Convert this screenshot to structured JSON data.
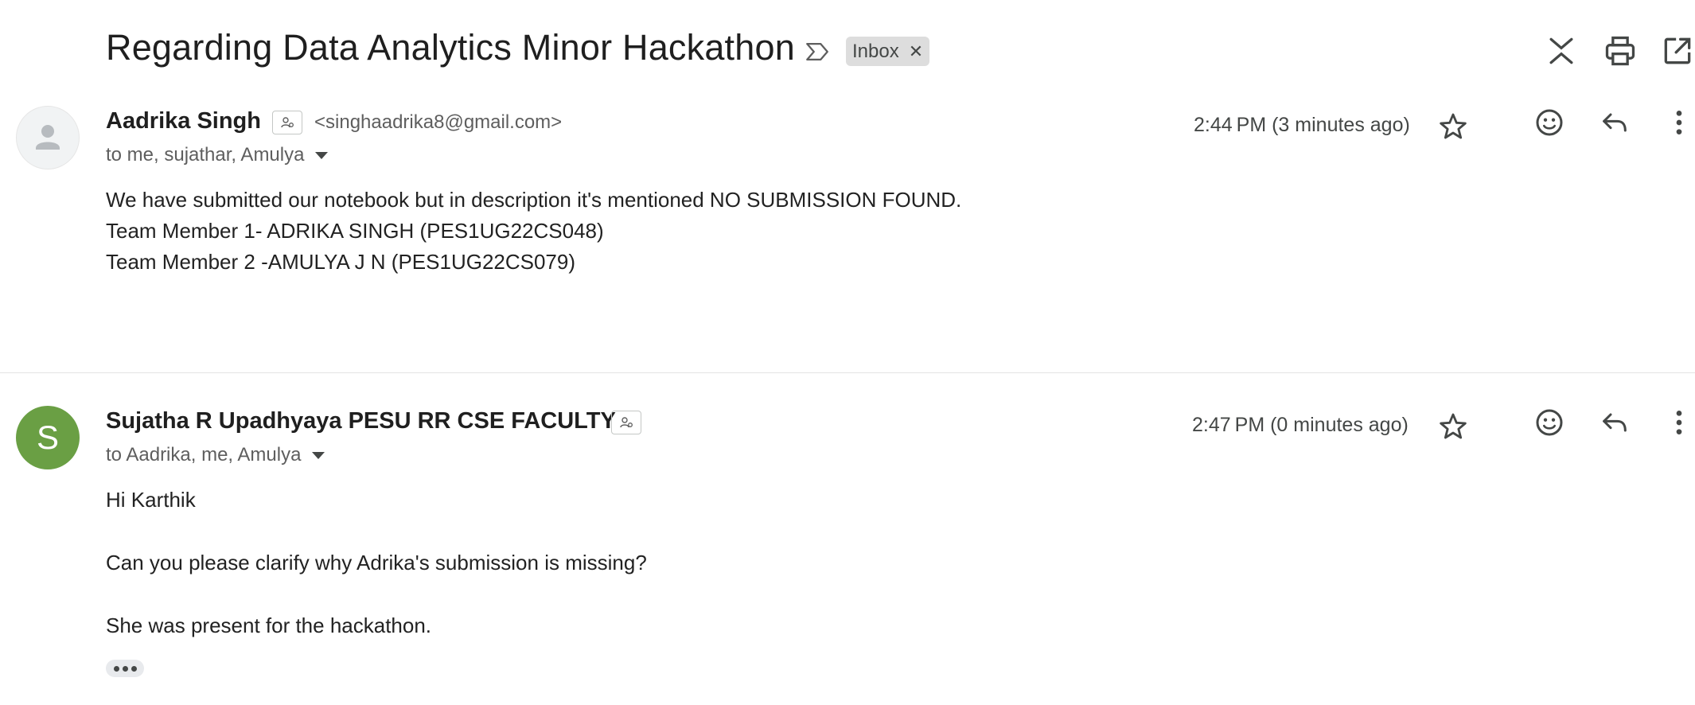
{
  "thread": {
    "subject": "Regarding Data Analytics Minor Hackathon",
    "label": "Inbox"
  },
  "icons": {
    "importance": "label-important-outline-icon",
    "collapse_all": "collapse-all-icon",
    "print": "print-icon",
    "open_new_window": "open-in-new-window-icon"
  },
  "messages": [
    {
      "sender_name": "Aadrika Singh",
      "sender_email": "<singhaadrika8@gmail.com>",
      "recipients": "to me, sujathar, Amulya",
      "time": "2:44 PM (3 minutes ago)",
      "avatar_letter": "",
      "body": [
        "We have submitted our notebook but in description it's mentioned NO SUBMISSION FOUND.",
        "Team Member 1- ADRIKA SINGH (PES1UG22CS048)",
        "Team Member 2 -AMULYA J N (PES1UG22CS079)"
      ]
    },
    {
      "sender_name": "Sujatha R Upadhyaya PESU RR CSE FACULTY",
      "sender_email": "",
      "recipients": "to Aadrika, me, Amulya",
      "time": "2:47 PM (0 minutes ago)",
      "avatar_letter": "S",
      "body": [
        "Hi Karthik",
        "Can you please clarify why Adrika's submission is missing?",
        "She was present for the hackathon."
      ]
    }
  ],
  "colors": {
    "avatar_green": "#6a9f44",
    "label_chip_bg": "#dddddd",
    "text_primary": "#1f1f1f",
    "text_secondary": "#5e5e5e"
  }
}
